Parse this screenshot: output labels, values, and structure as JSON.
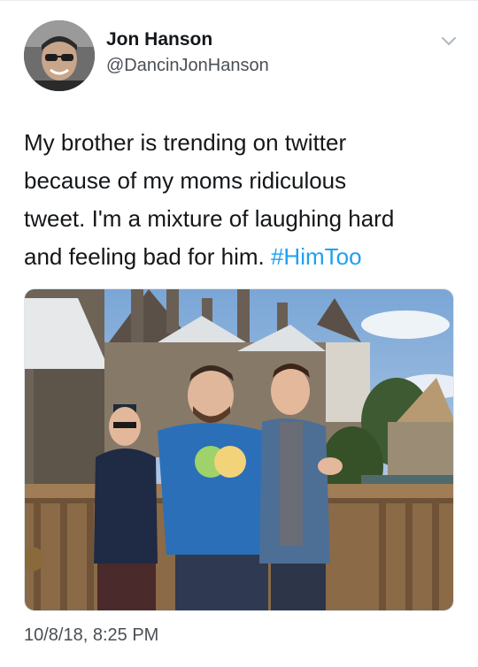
{
  "author": {
    "name": "Jon Hanson",
    "handle": "@DancinJonHanson",
    "avatar_icon": "profile-photo"
  },
  "tweet": {
    "text_lines": [
      "My brother is trending on twitter",
      "because of my moms ridiculous",
      "tweet. I'm a mixture of laughing hard",
      "and feeling bad for him. "
    ],
    "hashtag": "#HimToo",
    "timestamp": "10/8/18, 8:25 PM"
  },
  "menu": {
    "icon": "chevron-down-icon"
  },
  "colors": {
    "hashtag": "#1da1f2",
    "text": "#14171a",
    "secondary": "#4a4f55"
  }
}
